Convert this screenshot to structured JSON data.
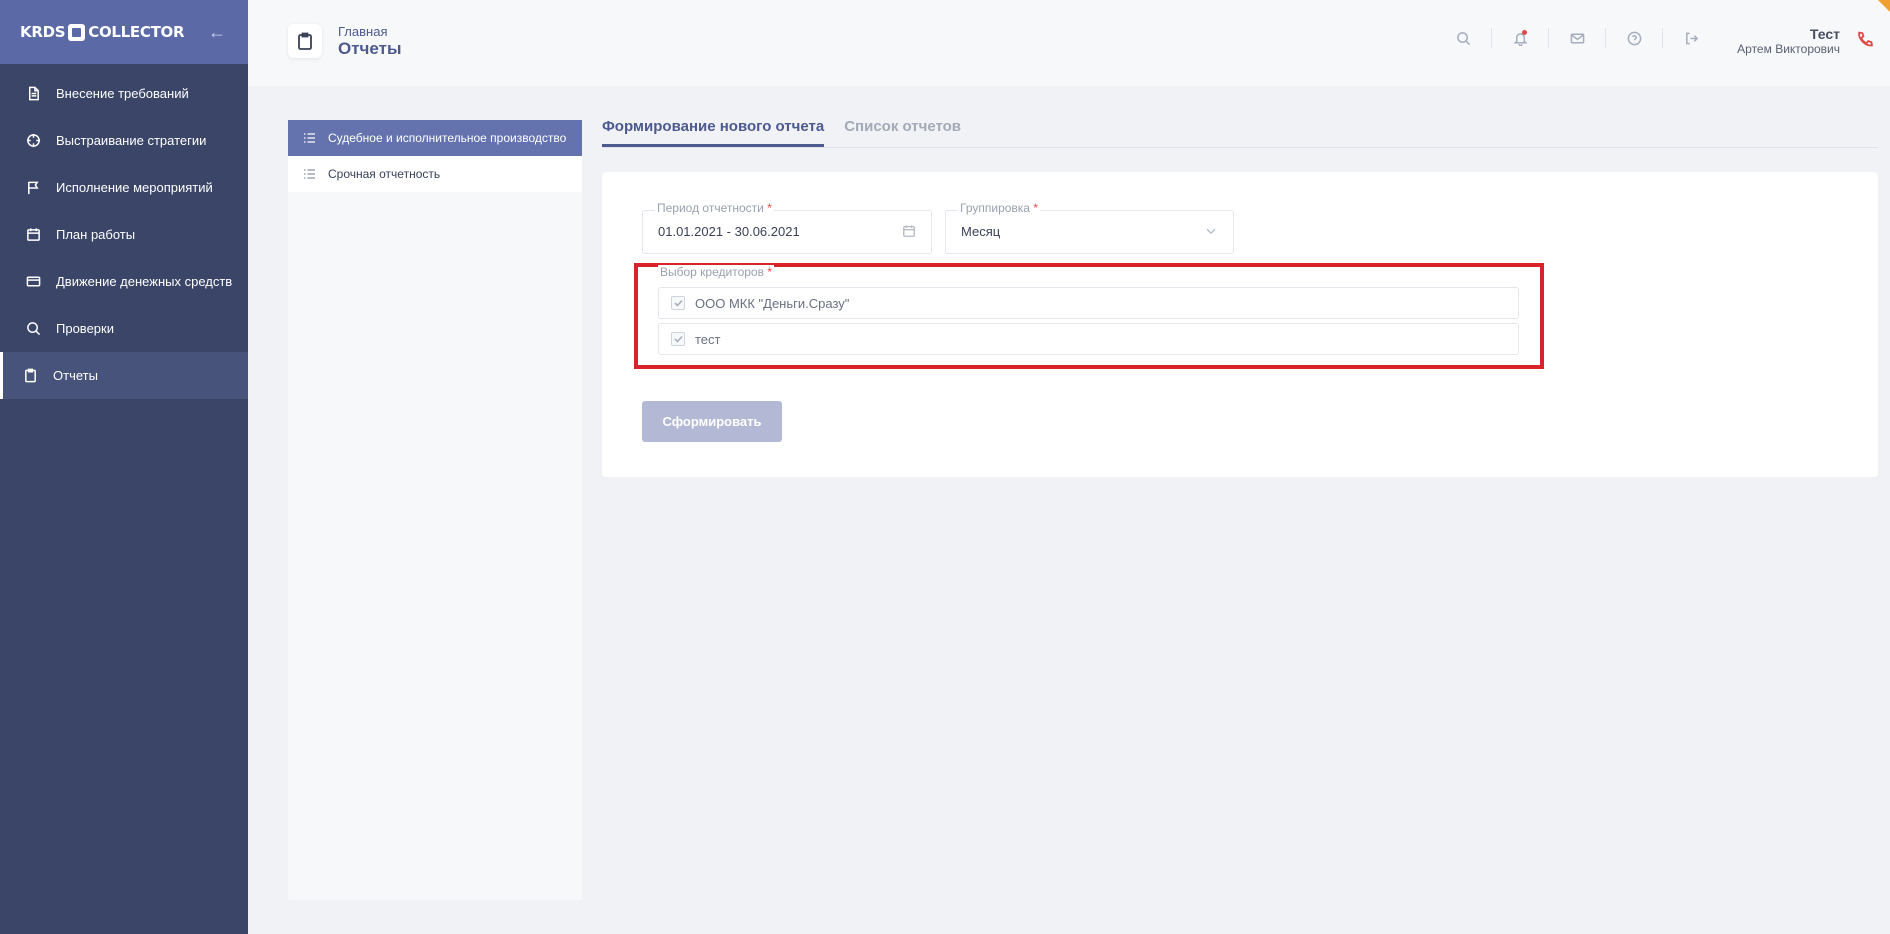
{
  "sidebar": {
    "logo_left": "KRDS",
    "logo_right": "COLLECTOR",
    "items": [
      {
        "label": "Внесение требований"
      },
      {
        "label": "Выстраивание стратегии"
      },
      {
        "label": "Исполнение мероприятий"
      },
      {
        "label": "План работы"
      },
      {
        "label": "Движение денежных средств"
      },
      {
        "label": "Проверки"
      },
      {
        "label": "Отчеты"
      }
    ]
  },
  "header": {
    "breadcrumb": "Главная",
    "title": "Отчеты",
    "user_name": "Тест",
    "user_sub": "Артем Викторович"
  },
  "reports": {
    "items": [
      {
        "label": "Судебное и исполнительное производство"
      },
      {
        "label": "Срочная отчетность"
      }
    ]
  },
  "tabs": [
    {
      "label": "Формирование нового отчета"
    },
    {
      "label": "Список отчетов"
    }
  ],
  "form": {
    "period_label": "Период отчетности",
    "period_value": "01.01.2021 - 30.06.2021",
    "grouping_label": "Группировка",
    "grouping_value": "Месяц",
    "required_mark": "*",
    "creditors_label": "Выбор кредиторов",
    "creditors": [
      {
        "label": "ООО МКК \"Деньги.Сразу\""
      },
      {
        "label": "тест"
      }
    ],
    "submit_label": "Сформировать"
  },
  "colors": {
    "sidebar_bg": "#3a4567",
    "sidebar_header": "#5b6aa6",
    "accent": "#4d5a8f",
    "highlight": "#d9232a"
  }
}
